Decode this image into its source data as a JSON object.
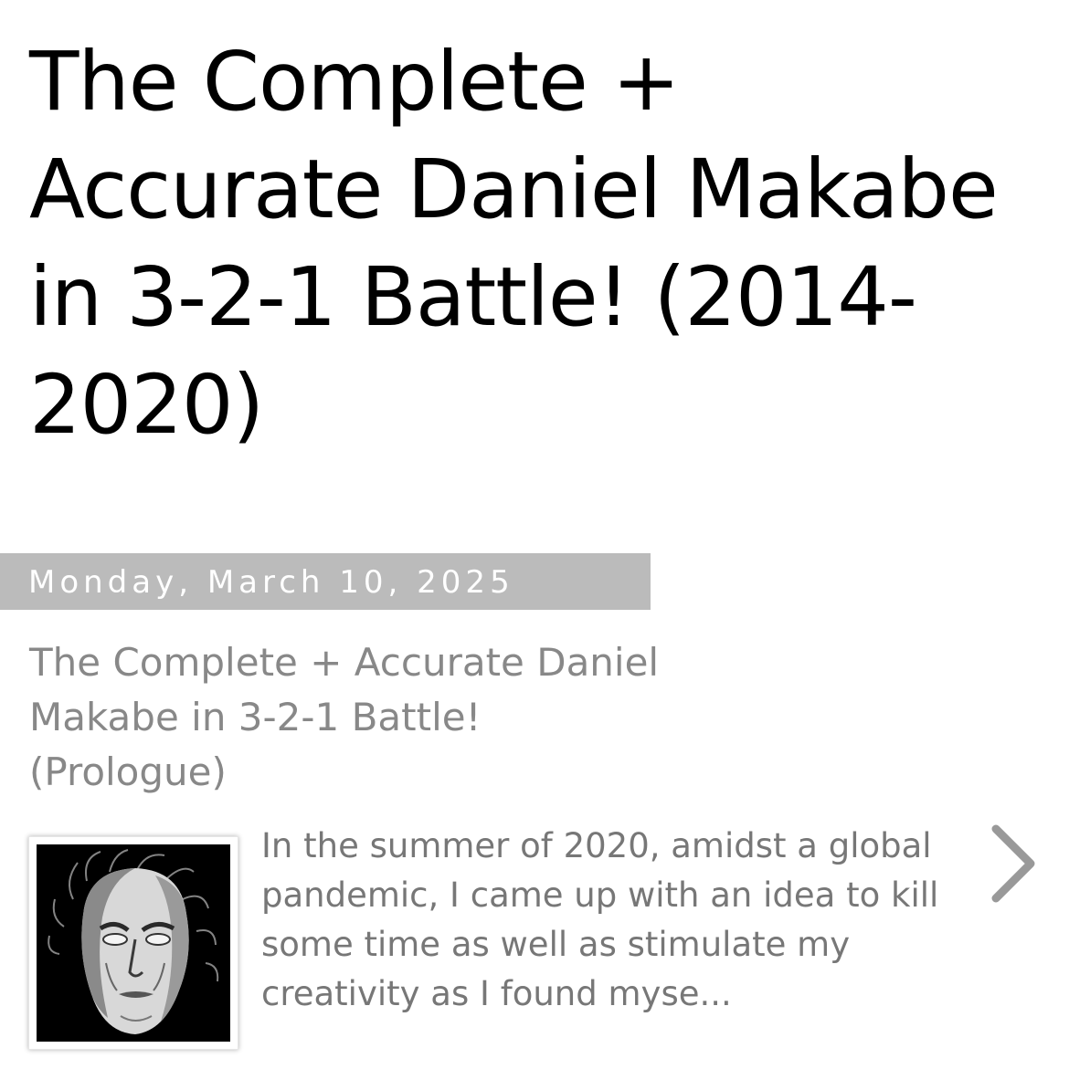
{
  "blog": {
    "title": "The Complete + Accurate Daniel Makabe in 3-2-1 Battle! (2014-2020)"
  },
  "post": {
    "date_header": "Monday, March 10, 2025",
    "title": "The Complete + Accurate Daniel Makabe in 3-2-1 Battle! (Prologue)",
    "snippet": "In the summer of 2020, amidst a global pandemic, I came up with an idea to kill some time as well as stimulate my creativity as I found myse...",
    "thumbnail_icon": "face-portrait-thumbnail",
    "next_icon": "chevron-right-icon"
  },
  "colors": {
    "date_bar": "#bbbbbb",
    "date_text": "#ffffff",
    "post_title": "#888888",
    "snippet_text": "#777777",
    "arrow": "#999999"
  }
}
